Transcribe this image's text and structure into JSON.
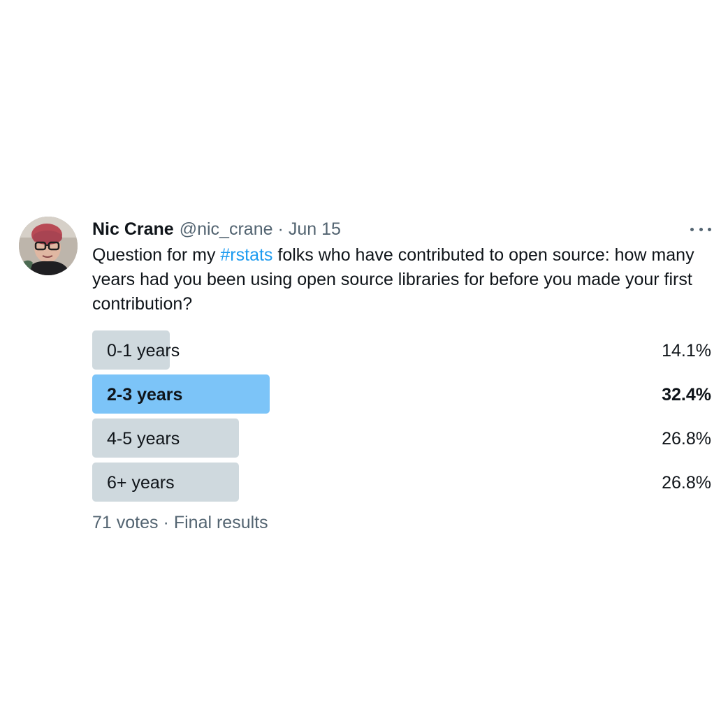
{
  "tweet": {
    "author_name": "Nic Crane",
    "handle": "@nic_crane",
    "separator": "·",
    "date": "Jun 15",
    "text_before": "Question for my ",
    "hashtag": "#rstats",
    "text_after": " folks who have contributed to open source: how many years had you been using open source libraries for before you made your first contribution?"
  },
  "poll": {
    "options": [
      {
        "label": "0-1 years",
        "percent_text": "14.1%",
        "percent": 14.1,
        "winner": false
      },
      {
        "label": "2-3 years",
        "percent_text": "32.4%",
        "percent": 32.4,
        "winner": true
      },
      {
        "label": "4-5 years",
        "percent_text": "26.8%",
        "percent": 26.8,
        "winner": false
      },
      {
        "label": "6+ years",
        "percent_text": "26.8%",
        "percent": 26.8,
        "winner": false
      }
    ],
    "votes": "71 votes",
    "separator": "·",
    "status": "Final results"
  },
  "colors": {
    "accent": "#1d9bf0",
    "winner_bar": "#7cc4f8",
    "bar": "#cfd9de",
    "secondary_text": "#536471"
  },
  "icons": {
    "more": "more-horizontal-icon"
  }
}
